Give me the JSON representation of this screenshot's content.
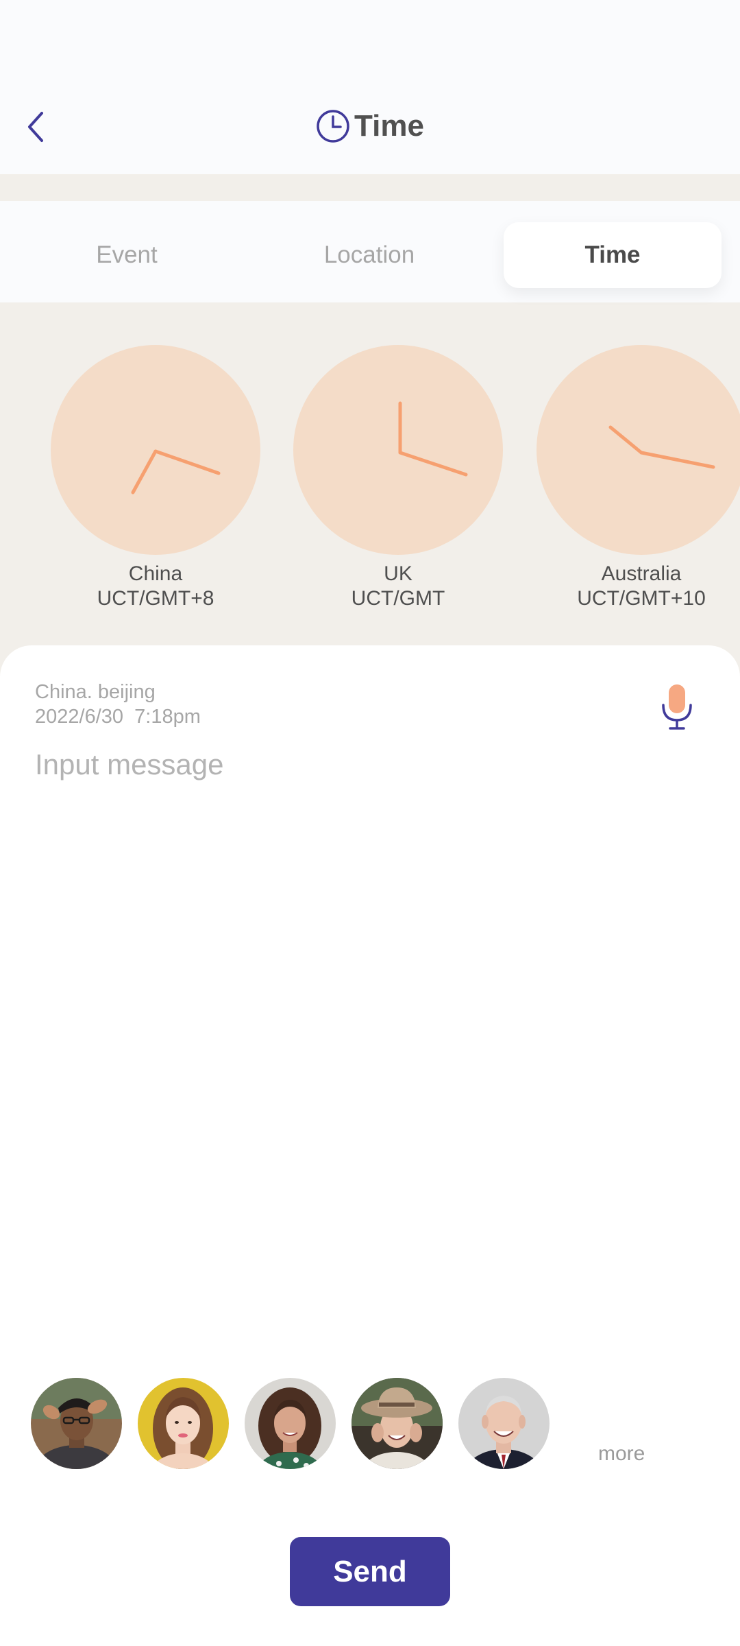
{
  "header": {
    "title": "Time",
    "back_icon": "chevron-left-icon",
    "title_icon": "clock-icon"
  },
  "tabs": [
    {
      "label": "Event",
      "active": false
    },
    {
      "label": "Location",
      "active": false
    },
    {
      "label": "Time",
      "active": true
    }
  ],
  "clocks": [
    {
      "country": "China",
      "zone": "UCT/GMT+8",
      "time": "7:18"
    },
    {
      "country": "UK",
      "zone": "UCT/GMT",
      "time": "12:18"
    },
    {
      "country": "Australia",
      "zone": "UCT/GMT+10",
      "time": "9:18"
    }
  ],
  "composer": {
    "location": "China. beijing",
    "datetime": "2022/6/30  7:18pm",
    "placeholder": "Input message",
    "mic_icon": "microphone-icon"
  },
  "recipients": {
    "avatars": [
      {
        "name": "avatar-man-glasses"
      },
      {
        "name": "avatar-woman-yellow"
      },
      {
        "name": "avatar-woman-curly"
      },
      {
        "name": "avatar-woman-hat"
      },
      {
        "name": "avatar-old-man"
      }
    ],
    "more_label": "more"
  },
  "send_label": "Send",
  "colors": {
    "accent": "#403a9a",
    "clock_face": "#f4dcc8",
    "clock_hand": "#f6a070",
    "mic": "#f6a882",
    "background": "#f2efea"
  }
}
